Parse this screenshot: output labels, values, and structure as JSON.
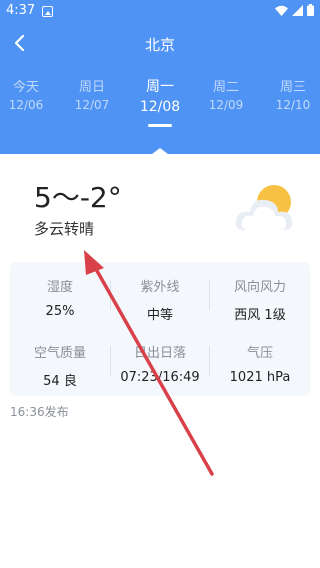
{
  "status_bar": {
    "time": "4:37"
  },
  "header": {
    "city": "北京",
    "days": [
      {
        "label": "今天",
        "date": "12/06"
      },
      {
        "label": "周日",
        "date": "12/07"
      },
      {
        "label": "周一",
        "date": "12/08",
        "active": true
      },
      {
        "label": "周二",
        "date": "12/09"
      },
      {
        "label": "周三",
        "date": "12/10"
      }
    ]
  },
  "current": {
    "temperature": "5～-2°",
    "description": "多云转晴",
    "icon": "partly-cloudy-icon"
  },
  "details": {
    "humidity": {
      "label": "湿度",
      "value": "25%"
    },
    "uv": {
      "label": "紫外线",
      "value": "中等"
    },
    "wind": {
      "label": "风向风力",
      "value": "西风 1级"
    },
    "aqi": {
      "label": "空气质量",
      "value": "54 良"
    },
    "sun": {
      "label": "日出日落",
      "value": "07:23/16:49"
    },
    "pressure": {
      "label": "气压",
      "value": "1021 hPa"
    }
  },
  "publish_time": "16:36发布",
  "colors": {
    "header": "#4f93f5",
    "arrow": "#d9414a"
  }
}
